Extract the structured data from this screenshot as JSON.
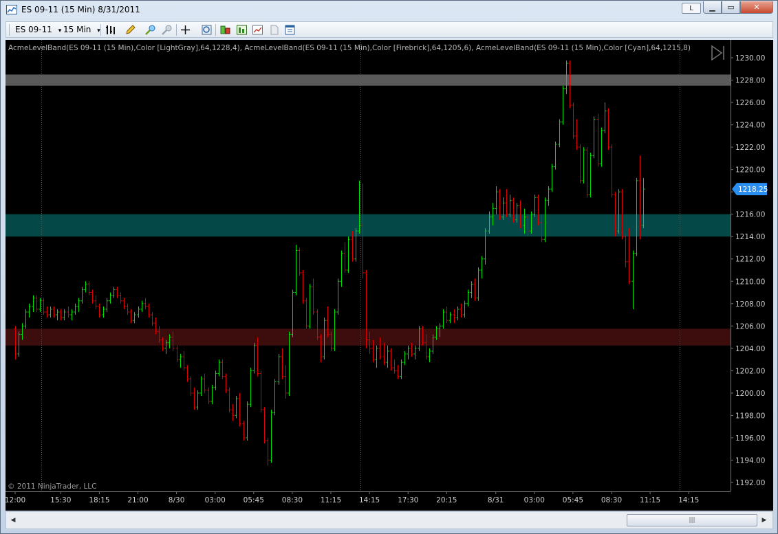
{
  "window": {
    "title": "ES 09-11 (15 Min)  8/31/2011",
    "btn_l": "L",
    "btn_min": "▁",
    "btn_max": "▭",
    "btn_close": "✕"
  },
  "toolbar": {
    "instrument": "ES 09-11",
    "interval": "15 Min",
    "dropdown_glyph": "▾"
  },
  "chart": {
    "indicator_label": "AcmeLevelBand(ES 09-11 (15 Min),Color [LightGray],64,1228,4), AcmeLevelBand(ES 09-11 (15 Min),Color [Firebrick],64,1205,6), AcmeLevelBand(ES 09-11 (15 Min),Color [Cyan],64,1215,8)",
    "copyright": "© 2011 NinjaTrader, LLC",
    "last_price_label": "1218.25",
    "colors": {
      "background": "#000000",
      "up": "#00e000",
      "down": "#e00000",
      "axis_text": "#cfcfcf",
      "band_lightgray": "#5a5a5a",
      "band_firebrick": "#3d0d0d",
      "band_cyan": "#054848",
      "price_marker": "#2a8ef0"
    }
  },
  "chart_data": {
    "type": "candlestick",
    "ylim": [
      1191.2,
      1231.6
    ],
    "yticks": [
      1192,
      1194,
      1196,
      1198,
      1200,
      1202,
      1204,
      1206,
      1208,
      1210,
      1212,
      1214,
      1216,
      1218,
      1220,
      1222,
      1224,
      1226,
      1228,
      1230
    ],
    "ytick_labels": [
      "1192.00",
      "1194.00",
      "1196.00",
      "1198.00",
      "1200.00",
      "1202.00",
      "1204.00",
      "1206.00",
      "1208.00",
      "1210.00",
      "1212.00",
      "1214.00",
      "1216.00",
      "1218.00",
      "1220.00",
      "1222.00",
      "1224.00",
      "1226.00",
      "1228.00",
      "1230.00"
    ],
    "xtick_labels": [
      {
        "bar": 0,
        "label": "12:00"
      },
      {
        "bar": 13,
        "label": "15:30"
      },
      {
        "bar": 24,
        "label": "18:15"
      },
      {
        "bar": 35,
        "label": "21:00"
      },
      {
        "bar": 46,
        "label": "8/30"
      },
      {
        "bar": 57,
        "label": "03:00"
      },
      {
        "bar": 68,
        "label": "05:45"
      },
      {
        "bar": 79,
        "label": "08:30"
      },
      {
        "bar": 90,
        "label": "11:15"
      },
      {
        "bar": 101,
        "label": "14:15"
      },
      {
        "bar": 112,
        "label": "17:30"
      },
      {
        "bar": 123,
        "label": "20:15"
      },
      {
        "bar": 137,
        "label": "8/31"
      },
      {
        "bar": 148,
        "label": "03:00"
      },
      {
        "bar": 159,
        "label": "05:45"
      },
      {
        "bar": 170,
        "label": "08:30"
      },
      {
        "bar": 181,
        "label": "11:15"
      },
      {
        "bar": 192,
        "label": "14:15"
      }
    ],
    "session_breaks": [
      7,
      98,
      189
    ],
    "bands": [
      {
        "name": "LightGray",
        "center": 1228,
        "height": 1.0
      },
      {
        "name": "Firebrick",
        "center": 1205,
        "height": 1.5
      },
      {
        "name": "Cyan",
        "center": 1215,
        "height": 2.0
      }
    ],
    "last_price": 1218.25,
    "ohlc": [
      [
        1205.75,
        1206.0,
        1203.0,
        1203.5
      ],
      [
        1203.5,
        1205.5,
        1203.25,
        1205.25
      ],
      [
        1205.25,
        1206.25,
        1204.75,
        1206.0
      ],
      [
        1206.0,
        1207.5,
        1205.75,
        1207.25
      ],
      [
        1207.25,
        1208.0,
        1206.75,
        1207.75
      ],
      [
        1207.75,
        1208.75,
        1207.25,
        1208.5
      ],
      [
        1208.5,
        1208.75,
        1207.25,
        1207.5
      ],
      [
        1207.5,
        1208.5,
        1207.25,
        1208.25
      ],
      [
        1208.25,
        1208.5,
        1207.0,
        1207.25
      ],
      [
        1207.25,
        1207.75,
        1206.75,
        1207.0
      ],
      [
        1207.0,
        1207.75,
        1206.75,
        1207.5
      ],
      [
        1207.5,
        1207.75,
        1206.75,
        1207.0
      ],
      [
        1207.0,
        1207.5,
        1206.5,
        1207.25
      ],
      [
        1207.25,
        1207.5,
        1206.5,
        1206.75
      ],
      [
        1206.75,
        1207.5,
        1206.5,
        1207.25
      ],
      [
        1207.25,
        1207.75,
        1206.75,
        1207.0
      ],
      [
        1207.0,
        1207.5,
        1206.5,
        1207.25
      ],
      [
        1207.25,
        1208.0,
        1207.0,
        1207.75
      ],
      [
        1207.75,
        1208.5,
        1207.25,
        1208.25
      ],
      [
        1208.25,
        1209.5,
        1208.0,
        1209.25
      ],
      [
        1209.25,
        1210.0,
        1209.0,
        1209.75
      ],
      [
        1209.75,
        1210.0,
        1208.75,
        1209.0
      ],
      [
        1209.0,
        1209.25,
        1208.0,
        1208.25
      ],
      [
        1208.25,
        1208.75,
        1207.5,
        1207.75
      ],
      [
        1207.75,
        1208.0,
        1206.75,
        1207.0
      ],
      [
        1207.0,
        1207.75,
        1206.75,
        1207.5
      ],
      [
        1207.5,
        1208.5,
        1207.25,
        1208.25
      ],
      [
        1208.25,
        1209.0,
        1208.0,
        1208.75
      ],
      [
        1208.75,
        1209.5,
        1208.5,
        1209.25
      ],
      [
        1209.25,
        1209.5,
        1208.5,
        1208.75
      ],
      [
        1208.75,
        1209.0,
        1208.0,
        1208.25
      ],
      [
        1208.25,
        1208.5,
        1207.5,
        1207.75
      ],
      [
        1207.75,
        1208.0,
        1207.0,
        1207.25
      ],
      [
        1207.25,
        1207.5,
        1206.25,
        1206.5
      ],
      [
        1206.5,
        1207.25,
        1206.25,
        1207.0
      ],
      [
        1207.0,
        1207.75,
        1206.75,
        1207.5
      ],
      [
        1207.5,
        1208.25,
        1207.25,
        1208.0
      ],
      [
        1208.0,
        1208.5,
        1207.5,
        1207.75
      ],
      [
        1207.75,
        1208.0,
        1206.75,
        1207.0
      ],
      [
        1207.0,
        1207.25,
        1206.0,
        1206.25
      ],
      [
        1206.25,
        1206.75,
        1205.25,
        1205.5
      ],
      [
        1205.5,
        1206.0,
        1204.5,
        1204.75
      ],
      [
        1204.75,
        1205.0,
        1203.75,
        1204.0
      ],
      [
        1204.0,
        1204.75,
        1203.5,
        1204.5
      ],
      [
        1204.5,
        1205.25,
        1204.0,
        1205.0
      ],
      [
        1205.0,
        1205.5,
        1203.75,
        1204.0
      ],
      [
        1204.0,
        1204.25,
        1202.75,
        1203.0
      ],
      [
        1203.0,
        1203.5,
        1202.25,
        1203.25
      ],
      [
        1203.25,
        1203.75,
        1202.0,
        1202.25
      ],
      [
        1202.25,
        1202.5,
        1201.0,
        1201.25
      ],
      [
        1201.25,
        1201.5,
        1199.75,
        1200.0
      ],
      [
        1200.0,
        1200.5,
        1198.5,
        1198.75
      ],
      [
        1198.75,
        1200.25,
        1198.5,
        1200.0
      ],
      [
        1200.0,
        1201.5,
        1199.75,
        1201.25
      ],
      [
        1201.25,
        1201.75,
        1200.0,
        1200.25
      ],
      [
        1200.25,
        1200.5,
        1199.0,
        1199.25
      ],
      [
        1199.25,
        1200.75,
        1199.0,
        1200.5
      ],
      [
        1200.5,
        1202.0,
        1200.25,
        1201.75
      ],
      [
        1201.75,
        1203.0,
        1201.5,
        1202.75
      ],
      [
        1202.75,
        1203.0,
        1201.25,
        1201.5
      ],
      [
        1201.5,
        1201.75,
        1200.0,
        1200.25
      ],
      [
        1200.25,
        1200.5,
        1198.25,
        1198.5
      ],
      [
        1198.5,
        1199.0,
        1197.5,
        1198.0
      ],
      [
        1198.0,
        1199.75,
        1197.75,
        1199.5
      ],
      [
        1199.5,
        1200.0,
        1197.0,
        1197.25
      ],
      [
        1197.25,
        1197.5,
        1195.75,
        1196.0
      ],
      [
        1196.0,
        1199.25,
        1195.75,
        1199.0
      ],
      [
        1199.0,
        1202.25,
        1198.75,
        1202.0
      ],
      [
        1202.0,
        1204.5,
        1201.75,
        1204.25
      ],
      [
        1204.25,
        1205.0,
        1201.5,
        1201.75
      ],
      [
        1201.75,
        1202.0,
        1198.25,
        1198.5
      ],
      [
        1198.5,
        1198.75,
        1195.5,
        1195.75
      ],
      [
        1195.75,
        1196.0,
        1193.5,
        1194.0
      ],
      [
        1194.0,
        1198.5,
        1193.75,
        1198.25
      ],
      [
        1198.25,
        1201.25,
        1198.0,
        1201.0
      ],
      [
        1201.0,
        1203.5,
        1200.75,
        1203.25
      ],
      [
        1203.25,
        1204.0,
        1201.25,
        1201.5
      ],
      [
        1201.5,
        1202.5,
        1199.5,
        1200.0
      ],
      [
        1200.0,
        1205.5,
        1199.75,
        1205.25
      ],
      [
        1205.25,
        1209.25,
        1205.0,
        1209.0
      ],
      [
        1209.0,
        1213.25,
        1208.75,
        1212.75
      ],
      [
        1212.75,
        1213.0,
        1210.5,
        1210.75
      ],
      [
        1210.75,
        1211.0,
        1208.0,
        1208.25
      ],
      [
        1208.25,
        1208.5,
        1205.75,
        1206.0
      ],
      [
        1206.0,
        1209.75,
        1205.75,
        1209.5
      ],
      [
        1209.5,
        1210.25,
        1207.0,
        1207.25
      ],
      [
        1207.25,
        1207.5,
        1204.75,
        1205.0
      ],
      [
        1205.0,
        1205.25,
        1202.75,
        1203.25
      ],
      [
        1203.25,
        1206.75,
        1203.0,
        1206.5
      ],
      [
        1206.5,
        1207.75,
        1205.0,
        1205.25
      ],
      [
        1205.25,
        1205.5,
        1203.75,
        1204.0
      ],
      [
        1204.0,
        1207.5,
        1203.75,
        1207.25
      ],
      [
        1207.25,
        1210.25,
        1207.0,
        1210.0
      ],
      [
        1210.0,
        1212.75,
        1209.5,
        1212.5
      ],
      [
        1212.5,
        1213.5,
        1210.75,
        1211.0
      ],
      [
        1211.0,
        1214.0,
        1210.75,
        1213.75
      ],
      [
        1213.75,
        1214.5,
        1211.75,
        1212.0
      ],
      [
        1212.0,
        1214.75,
        1211.75,
        1214.5
      ],
      [
        1214.5,
        1219.0,
        1214.25,
        1215.0
      ],
      [
        1215.0,
        1218.75,
        1210.25,
        1210.75
      ],
      [
        1210.75,
        1211.0,
        1204.0,
        1204.75
      ],
      [
        1204.75,
        1205.5,
        1203.5,
        1204.0
      ],
      [
        1204.0,
        1204.75,
        1202.75,
        1203.0
      ],
      [
        1203.0,
        1204.25,
        1202.25,
        1204.0
      ],
      [
        1204.0,
        1205.0,
        1203.0,
        1203.25
      ],
      [
        1203.25,
        1204.5,
        1202.5,
        1202.75
      ],
      [
        1202.75,
        1204.25,
        1202.25,
        1203.75
      ],
      [
        1203.75,
        1204.0,
        1202.0,
        1202.25
      ],
      [
        1202.25,
        1203.0,
        1201.75,
        1202.0
      ],
      [
        1202.0,
        1202.5,
        1201.25,
        1201.5
      ],
      [
        1201.5,
        1203.0,
        1201.25,
        1202.75
      ],
      [
        1202.75,
        1203.75,
        1202.5,
        1203.5
      ],
      [
        1203.5,
        1204.25,
        1203.0,
        1204.0
      ],
      [
        1204.0,
        1204.5,
        1203.25,
        1203.5
      ],
      [
        1203.5,
        1204.25,
        1203.0,
        1204.0
      ],
      [
        1204.0,
        1206.0,
        1203.75,
        1205.75
      ],
      [
        1205.75,
        1206.0,
        1204.25,
        1204.5
      ],
      [
        1204.5,
        1205.25,
        1203.0,
        1203.25
      ],
      [
        1203.25,
        1204.0,
        1202.75,
        1203.75
      ],
      [
        1203.75,
        1205.25,
        1203.5,
        1205.0
      ],
      [
        1205.0,
        1206.0,
        1204.75,
        1205.75
      ],
      [
        1205.75,
        1206.25,
        1205.0,
        1206.0
      ],
      [
        1206.0,
        1207.5,
        1205.75,
        1207.25
      ],
      [
        1207.25,
        1207.75,
        1206.25,
        1206.5
      ],
      [
        1206.5,
        1207.25,
        1206.25,
        1207.0
      ],
      [
        1207.0,
        1207.5,
        1206.25,
        1206.75
      ],
      [
        1206.75,
        1207.75,
        1206.5,
        1207.5
      ],
      [
        1207.5,
        1208.0,
        1206.75,
        1207.0
      ],
      [
        1207.0,
        1208.25,
        1206.75,
        1208.0
      ],
      [
        1208.0,
        1209.25,
        1207.75,
        1209.0
      ],
      [
        1209.0,
        1210.0,
        1208.5,
        1209.75
      ],
      [
        1209.75,
        1210.25,
        1208.25,
        1208.5
      ],
      [
        1208.5,
        1211.25,
        1208.25,
        1211.0
      ],
      [
        1211.0,
        1212.25,
        1210.25,
        1212.0
      ],
      [
        1212.0,
        1214.75,
        1211.5,
        1214.5
      ],
      [
        1214.5,
        1216.25,
        1214.25,
        1215.75
      ],
      [
        1215.75,
        1217.0,
        1215.0,
        1216.5
      ],
      [
        1216.5,
        1218.5,
        1216.0,
        1218.0
      ],
      [
        1218.0,
        1218.25,
        1215.5,
        1215.75
      ],
      [
        1215.75,
        1217.5,
        1215.5,
        1217.0
      ],
      [
        1217.0,
        1218.25,
        1215.75,
        1216.0
      ],
      [
        1216.0,
        1217.75,
        1215.75,
        1217.25
      ],
      [
        1217.25,
        1217.5,
        1215.25,
        1215.5
      ],
      [
        1215.5,
        1217.0,
        1215.25,
        1216.75
      ],
      [
        1216.75,
        1217.25,
        1214.75,
        1215.0
      ],
      [
        1215.0,
        1216.5,
        1214.25,
        1215.75
      ],
      [
        1215.75,
        1216.0,
        1214.0,
        1214.5
      ],
      [
        1214.5,
        1216.25,
        1214.25,
        1216.0
      ],
      [
        1216.0,
        1217.75,
        1215.75,
        1217.5
      ],
      [
        1217.5,
        1217.75,
        1215.0,
        1215.25
      ],
      [
        1215.25,
        1216.0,
        1213.5,
        1213.75
      ],
      [
        1213.75,
        1217.5,
        1213.5,
        1217.25
      ],
      [
        1217.25,
        1218.5,
        1216.75,
        1218.25
      ],
      [
        1218.25,
        1220.5,
        1218.0,
        1220.25
      ],
      [
        1220.25,
        1222.5,
        1220.0,
        1222.25
      ],
      [
        1222.25,
        1224.5,
        1222.0,
        1224.25
      ],
      [
        1224.25,
        1227.5,
        1224.0,
        1227.25
      ],
      [
        1227.25,
        1229.75,
        1226.75,
        1229.5
      ],
      [
        1229.5,
        1229.75,
        1225.5,
        1225.75
      ],
      [
        1225.75,
        1226.0,
        1222.75,
        1223.0
      ],
      [
        1223.0,
        1224.5,
        1221.75,
        1222.0
      ],
      [
        1222.0,
        1222.25,
        1218.75,
        1219.0
      ],
      [
        1219.0,
        1222.0,
        1218.75,
        1221.75
      ],
      [
        1221.75,
        1222.0,
        1217.5,
        1217.75
      ],
      [
        1217.75,
        1221.5,
        1217.5,
        1221.25
      ],
      [
        1221.25,
        1224.75,
        1221.0,
        1224.5
      ],
      [
        1224.5,
        1225.0,
        1220.25,
        1220.5
      ],
      [
        1220.5,
        1223.75,
        1220.25,
        1223.5
      ],
      [
        1223.5,
        1226.0,
        1223.25,
        1225.25
      ],
      [
        1225.25,
        1225.5,
        1221.75,
        1222.0
      ],
      [
        1222.0,
        1222.25,
        1217.5,
        1217.75
      ],
      [
        1217.75,
        1218.0,
        1214.0,
        1214.5
      ],
      [
        1214.5,
        1218.25,
        1214.25,
        1218.0
      ],
      [
        1218.0,
        1218.25,
        1213.75,
        1214.0
      ],
      [
        1214.0,
        1214.25,
        1211.25,
        1211.75
      ],
      [
        1211.75,
        1214.75,
        1209.75,
        1210.0
      ],
      [
        1210.0,
        1212.75,
        1207.5,
        1212.5
      ],
      [
        1212.5,
        1219.25,
        1212.25,
        1219.0
      ],
      [
        1219.0,
        1221.25,
        1213.75,
        1215.0
      ],
      [
        1215.0,
        1219.25,
        1214.75,
        1218.25
      ]
    ]
  }
}
